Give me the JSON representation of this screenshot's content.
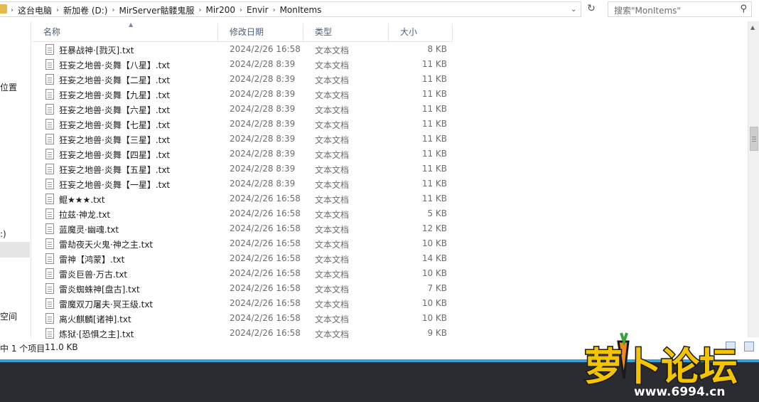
{
  "address_bar": {
    "crumbs": [
      "这台电脑",
      "新加卷 (D:)",
      "MirServer骷髅鬼服",
      "Mir200",
      "Envir",
      "MonItems"
    ]
  },
  "search": {
    "placeholder": "搜索\"MonItems\""
  },
  "nav_fragments": [
    "位置",
    ":)",
    "空间"
  ],
  "columns": {
    "name": "名称",
    "date": "修改日期",
    "type": "类型",
    "size": "大小"
  },
  "files": [
    {
      "name": "狂暴战神·[戮灭].txt",
      "date": "2024/2/26 16:58",
      "type": "文本文档",
      "size": "8 KB"
    },
    {
      "name": "狂妄之地兽·炎舞【八星】.txt",
      "date": "2024/2/28 8:39",
      "type": "文本文档",
      "size": "11 KB"
    },
    {
      "name": "狂妄之地兽·炎舞【二星】.txt",
      "date": "2024/2/28 8:39",
      "type": "文本文档",
      "size": "11 KB"
    },
    {
      "name": "狂妄之地兽·炎舞【九星】.txt",
      "date": "2024/2/28 8:39",
      "type": "文本文档",
      "size": "11 KB"
    },
    {
      "name": "狂妄之地兽·炎舞【六星】.txt",
      "date": "2024/2/28 8:39",
      "type": "文本文档",
      "size": "11 KB"
    },
    {
      "name": "狂妄之地兽·炎舞【七星】.txt",
      "date": "2024/2/28 8:39",
      "type": "文本文档",
      "size": "11 KB"
    },
    {
      "name": "狂妄之地兽·炎舞【三星】.txt",
      "date": "2024/2/28 8:39",
      "type": "文本文档",
      "size": "11 KB"
    },
    {
      "name": "狂妄之地兽·炎舞【四星】.txt",
      "date": "2024/2/28 8:39",
      "type": "文本文档",
      "size": "11 KB"
    },
    {
      "name": "狂妄之地兽·炎舞【五星】.txt",
      "date": "2024/2/28 8:39",
      "type": "文本文档",
      "size": "11 KB"
    },
    {
      "name": "狂妄之地兽·炎舞【一星】.txt",
      "date": "2024/2/28 8:39",
      "type": "文本文档",
      "size": "11 KB"
    },
    {
      "name": "鲲★★★.txt",
      "date": "2024/2/26 16:58",
      "type": "文本文档",
      "size": "11 KB"
    },
    {
      "name": "拉兹·神龙.txt",
      "date": "2024/2/26 16:58",
      "type": "文本文档",
      "size": "5 KB"
    },
    {
      "name": "蓝魔灵·幽魂.txt",
      "date": "2024/2/26 16:58",
      "type": "文本文档",
      "size": "12 KB"
    },
    {
      "name": "雷劫夜天火鬼·神之主.txt",
      "date": "2024/2/26 16:58",
      "type": "文本文档",
      "size": "10 KB"
    },
    {
      "name": "雷神【鸿蒙】.txt",
      "date": "2024/2/26 16:58",
      "type": "文本文档",
      "size": "14 KB"
    },
    {
      "name": "雷炎巨兽·万古.txt",
      "date": "2024/2/26 16:58",
      "type": "文本文档",
      "size": "10 KB"
    },
    {
      "name": "雷炎蜘蛛神[盘古].txt",
      "date": "2024/2/26 16:58",
      "type": "文本文档",
      "size": "7 KB"
    },
    {
      "name": "雷魔双刀屠夫·冥王级.txt",
      "date": "2024/2/26 16:58",
      "type": "文本文档",
      "size": "10 KB"
    },
    {
      "name": "离火麒麟[诸神].txt",
      "date": "2024/2/26 16:58",
      "type": "文本文档",
      "size": "10 KB"
    },
    {
      "name": "炼狱·[恐惧之主].txt",
      "date": "2024/2/26 16:58",
      "type": "文本文档",
      "size": "9 KB"
    }
  ],
  "status": {
    "selected": "中 1 个项目",
    "size": "11.0 KB"
  },
  "watermark": {
    "brand": "萝卜论坛",
    "url": "www.6994.cn"
  },
  "colors": {
    "accent_line": "#3aa0d8",
    "header_text": "#4c607a",
    "folder": "#e6b94a"
  }
}
